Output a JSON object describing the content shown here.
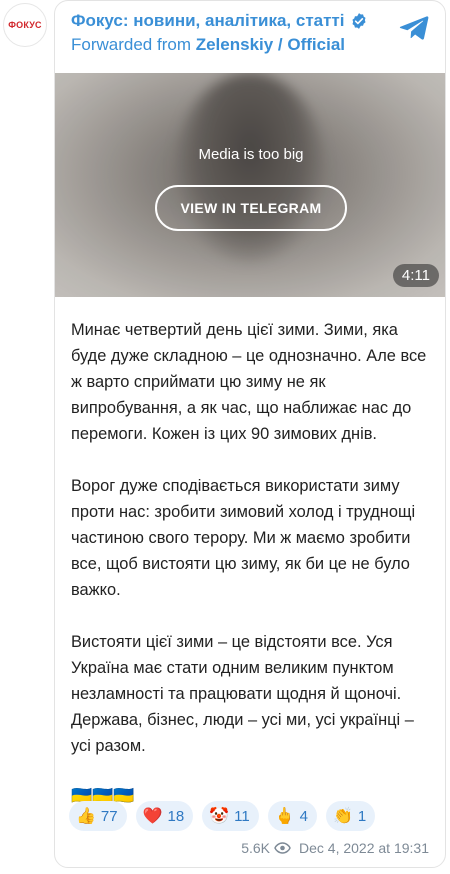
{
  "avatar": {
    "label": "ФОКУС"
  },
  "header": {
    "channel_name": "Фокус: новини, аналітика, статті",
    "forwarded_prefix": "Forwarded from",
    "forwarded_source": "Zelenskiy / Official"
  },
  "media": {
    "message": "Media is too big",
    "button_label": "VIEW IN TELEGRAM",
    "duration": "4:11"
  },
  "post": {
    "paragraphs": [
      "Минає четвертий день цієї зими. Зими, яка буде дуже складною – це однозначно. Але все ж варто сприймати цю зиму не як випробування, а як час, що наближає нас до перемоги. Кожен із цих 90 зимових днів.",
      "Ворог дуже сподівається використати зиму проти нас: зробити зимовий холод і труднощі частиною свого терору. Ми ж маємо зробити все, щоб вистояти цю зиму, як би це не було важко.",
      "Вистояти цієї зими – це відстояти все. Уся Україна має стати одним великим пунктом незламності та працювати щодня й щоночі. Держава, бізнес, люди – усі ми, усі українці – усі разом."
    ],
    "flags": "🇺🇦🇺🇦🇺🇦"
  },
  "reactions": [
    {
      "emoji": "👍",
      "count": "77"
    },
    {
      "emoji": "❤️",
      "count": "18"
    },
    {
      "emoji": "🤡",
      "count": "11"
    },
    {
      "emoji": "🖕",
      "count": "4"
    },
    {
      "emoji": "👏",
      "count": "1"
    }
  ],
  "footer": {
    "views": "5.6K",
    "date": "Dec 4, 2022 at 19:31"
  },
  "colors": {
    "accent": "#3a8fd6",
    "reaction_bg": "#e8f1fb",
    "brand_red": "#d1262b"
  }
}
